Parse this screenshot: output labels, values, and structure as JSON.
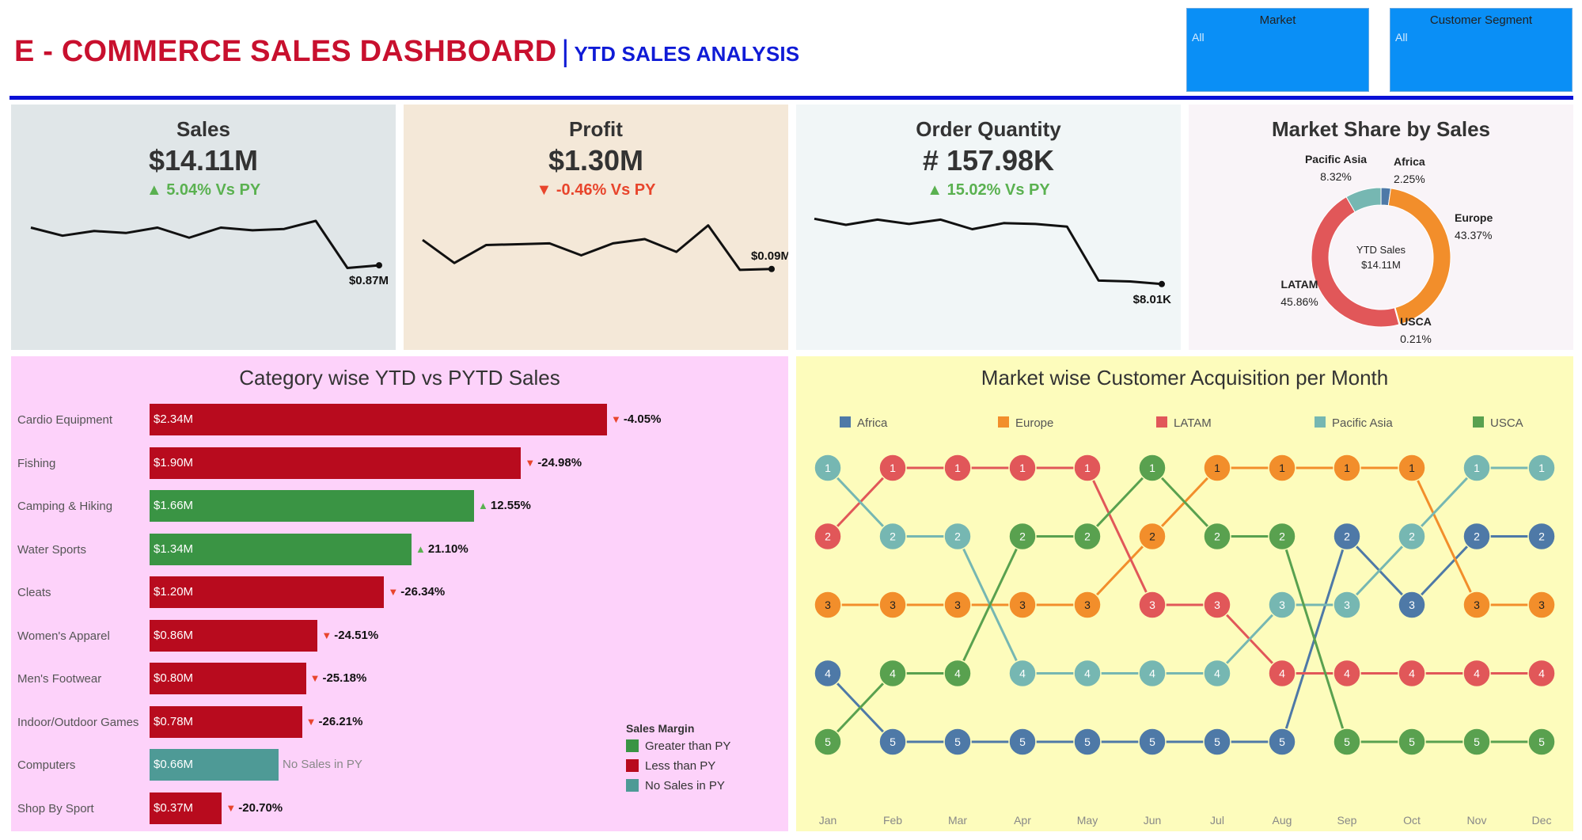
{
  "header": {
    "title": "E - COMMERCE SALES DASHBOARD",
    "separator": "|",
    "subtitle": "YTD SALES ANALYSIS"
  },
  "filters": [
    {
      "label": "Market",
      "value": "All"
    },
    {
      "label": "Customer Segment",
      "value": "All"
    }
  ],
  "kpis": {
    "sales": {
      "title": "Sales",
      "value": "$14.11M",
      "delta": "5.04% Vs PY",
      "direction": "up",
      "end_label": "$0.87M",
      "spark": [
        0.7,
        0.58,
        0.65,
        0.62,
        0.7,
        0.55,
        0.7,
        0.66,
        0.68,
        0.8,
        0.1,
        0.14
      ]
    },
    "profit": {
      "title": "Profit",
      "value": "$1.30M",
      "delta": "-0.46% Vs PY",
      "direction": "down",
      "end_label": "$0.09M",
      "spark": [
        0.62,
        0.35,
        0.56,
        0.57,
        0.58,
        0.44,
        0.58,
        0.63,
        0.48,
        0.79,
        0.27,
        0.28
      ]
    },
    "orders": {
      "title": "Order Quantity",
      "value": "# 157.98K",
      "delta": "15.02% Vs PY",
      "direction": "up",
      "end_label": "$8.01K",
      "spark": [
        0.87,
        0.8,
        0.86,
        0.81,
        0.86,
        0.75,
        0.82,
        0.81,
        0.78,
        0.16,
        0.15,
        0.12
      ]
    }
  },
  "market_share": {
    "title": "Market Share by Sales",
    "center_label": "YTD Sales",
    "center_value": "$14.11M",
    "colors": {
      "Africa": "#4e79a7",
      "Europe": "#f28e2b",
      "USCA": "#59a14f",
      "LATAM": "#e15759",
      "Pacific Asia": "#76b7b2"
    },
    "labels": {
      "Africa": {
        "name": "Africa",
        "pct": "2.25%"
      },
      "Europe": {
        "name": "Europe",
        "pct": "43.37%"
      },
      "USCA": {
        "name": "USCA",
        "pct": "0.21%"
      },
      "LATAM": {
        "name": "LATAM",
        "pct": "45.86%"
      },
      "Pacific Asia": {
        "name": "Pacific Asia",
        "pct": "8.32%"
      }
    }
  },
  "category_chart": {
    "title": "Category wise YTD vs PYTD Sales",
    "legend_title": "Sales Margin",
    "legend": [
      {
        "label": "Greater than PY",
        "color": "#3a9444"
      },
      {
        "label": "Less than PY",
        "color": "#b80b1e"
      },
      {
        "label": "No Sales in PY",
        "color": "#4e9a96"
      }
    ],
    "no_py_label": "No Sales in PY"
  },
  "rank_chart": {
    "title": "Market wise Customer Acquisition per Month"
  },
  "chart_data": [
    {
      "type": "line",
      "title": "Sales",
      "x": [
        "1",
        "2",
        "3",
        "4",
        "5",
        "6",
        "7",
        "8",
        "9",
        "10",
        "11",
        "12"
      ],
      "values_normalized": [
        0.7,
        0.58,
        0.65,
        0.62,
        0.7,
        0.55,
        0.7,
        0.66,
        0.68,
        0.8,
        0.1,
        0.14
      ],
      "last_value": "$0.87M"
    },
    {
      "type": "pie",
      "title": "Market Share by Sales",
      "labels": [
        "Africa",
        "Europe",
        "USCA",
        "LATAM",
        "Pacific Asia"
      ],
      "values": [
        2.25,
        43.37,
        0.21,
        45.86,
        8.32
      ]
    },
    {
      "type": "bar",
      "title": "Category wise YTD vs PYTD Sales",
      "categories": [
        "Cardio Equipment",
        "Fishing",
        "Camping & Hiking",
        "Water Sports",
        "Cleats",
        "Women's Apparel",
        "Men's Footwear",
        "Indoor/Outdoor Games",
        "Computers",
        "Shop By Sport"
      ],
      "values": [
        2.34,
        1.9,
        1.66,
        1.34,
        1.2,
        0.86,
        0.8,
        0.78,
        0.66,
        0.37
      ],
      "value_labels": [
        "$2.34M",
        "$1.90M",
        "$1.66M",
        "$1.34M",
        "$1.20M",
        "$0.86M",
        "$0.80M",
        "$0.78M",
        "$0.66M",
        "$0.37M"
      ],
      "delta_labels": [
        "-4.05%",
        "-24.98%",
        "12.55%",
        "21.10%",
        "-26.34%",
        "-24.51%",
        "-25.18%",
        "-26.21%",
        "",
        "-20.70%"
      ],
      "margin": [
        "less",
        "less",
        "greater",
        "greater",
        "less",
        "less",
        "less",
        "less",
        "none",
        "less"
      ]
    },
    {
      "type": "line",
      "title": "Market wise Customer Acquisition per Month",
      "x": [
        "Jan",
        "Feb",
        "Mar",
        "Apr",
        "May",
        "Jun",
        "Jul",
        "Aug",
        "Sep",
        "Oct",
        "Nov",
        "Dec"
      ],
      "y_reversed": true,
      "series": [
        {
          "name": "Africa",
          "color": "#4e79a7",
          "values": [
            4,
            5,
            5,
            5,
            5,
            5,
            5,
            5,
            2,
            3,
            2,
            2
          ]
        },
        {
          "name": "Europe",
          "color": "#f28e2b",
          "values": [
            3,
            3,
            3,
            3,
            3,
            2,
            1,
            1,
            1,
            1,
            3,
            3
          ]
        },
        {
          "name": "LATAM",
          "color": "#e15759",
          "values": [
            2,
            1,
            1,
            1,
            1,
            3,
            3,
            4,
            4,
            4,
            4,
            4
          ]
        },
        {
          "name": "Pacific Asia",
          "color": "#76b7b2",
          "values": [
            1,
            2,
            2,
            4,
            4,
            4,
            4,
            3,
            3,
            2,
            1,
            1
          ]
        },
        {
          "name": "USCA",
          "color": "#59a14f",
          "values": [
            5,
            4,
            4,
            2,
            2,
            1,
            2,
            2,
            5,
            5,
            5,
            5
          ]
        }
      ]
    }
  ]
}
